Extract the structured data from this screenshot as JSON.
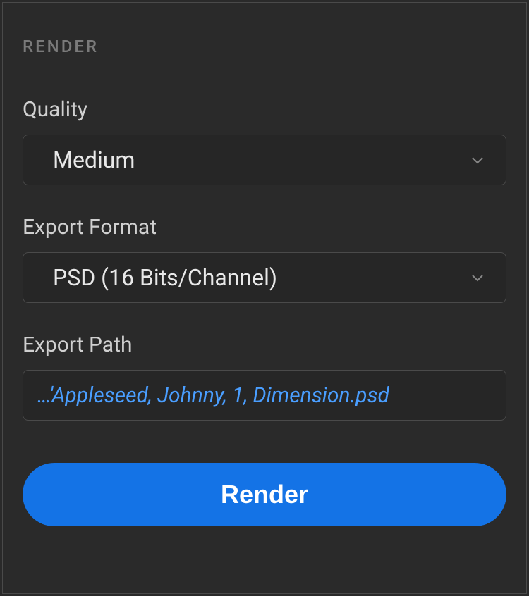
{
  "panel": {
    "header": "RENDER"
  },
  "quality": {
    "label": "Quality",
    "value": "Medium"
  },
  "exportFormat": {
    "label": "Export Format",
    "value": "PSD (16 Bits/Channel)"
  },
  "exportPath": {
    "label": "Export Path",
    "value": "…'Appleseed, Johnny, 1, Dimension.psd"
  },
  "actions": {
    "renderLabel": "Render"
  }
}
